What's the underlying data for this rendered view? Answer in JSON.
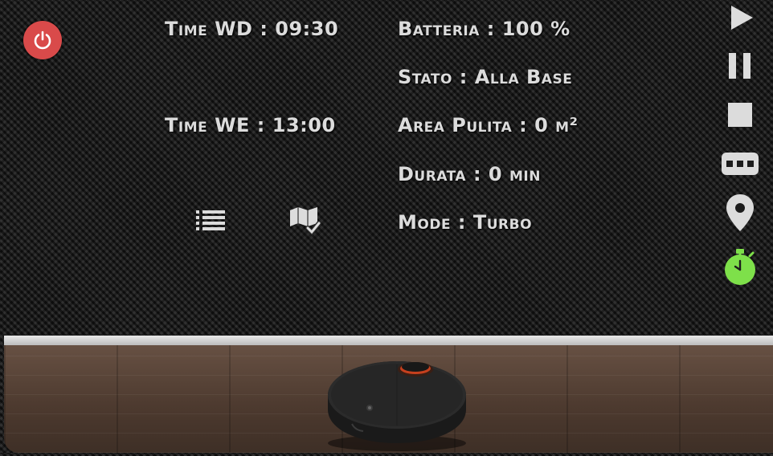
{
  "schedule": {
    "weekday": "Time WD : 09:30",
    "weekend": "Time WE : 13:00"
  },
  "status": {
    "battery": "Batteria : 100 %",
    "state": "Stato : Alla Base",
    "area": "Area Pulita : 0 m²",
    "duration": "Durata : 0 min",
    "mode": "Mode : Turbo"
  },
  "icons": {
    "power": "power-icon",
    "list": "list-icon",
    "map": "map-check-icon",
    "play": "play-icon",
    "pause": "pause-icon",
    "stop": "stop-icon",
    "fan": "fan-speed-icon",
    "location": "location-pin-icon",
    "timer": "timer-icon"
  },
  "colors": {
    "power_button": "#d94a4a",
    "timer_active": "#7ee04a",
    "text": "#dcdcdc"
  }
}
